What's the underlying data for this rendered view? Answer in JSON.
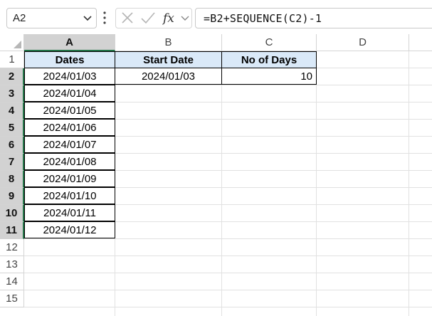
{
  "name_box": {
    "value": "A2"
  },
  "formula_bar": {
    "formula": "=B2+SEQUENCE(C2)-1"
  },
  "columns": [
    "A",
    "B",
    "C",
    "D"
  ],
  "rows": [
    "1",
    "2",
    "3",
    "4",
    "5",
    "6",
    "7",
    "8",
    "9",
    "10",
    "11",
    "12",
    "13",
    "14",
    "15"
  ],
  "headers": {
    "dates": "Dates",
    "start_date": "Start Date",
    "no_of_days": "No of Days"
  },
  "dates": [
    "2024/01/03",
    "2024/01/04",
    "2024/01/05",
    "2024/01/06",
    "2024/01/07",
    "2024/01/08",
    "2024/01/09",
    "2024/01/10",
    "2024/01/11",
    "2024/01/12"
  ],
  "start_date": "2024/01/03",
  "no_of_days": "10",
  "colors": {
    "header_fill": "#dae9f8",
    "selection_accent": "#217346",
    "grid_line": "#e1e1e1"
  }
}
